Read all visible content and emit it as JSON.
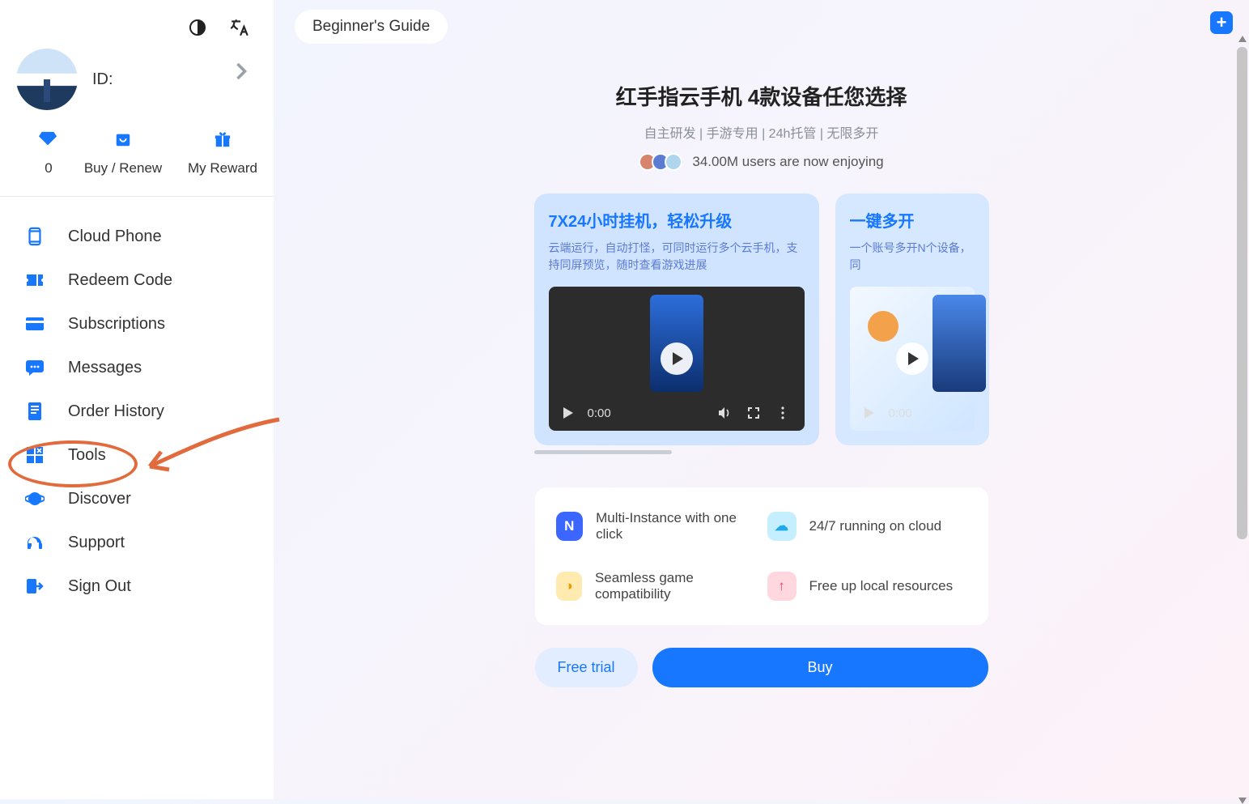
{
  "sidebar": {
    "id_label": "ID:",
    "quick": {
      "balance": "0",
      "buy_renew": "Buy / Renew",
      "my_reward": "My Reward"
    },
    "nav": [
      {
        "label": "Cloud Phone"
      },
      {
        "label": "Redeem Code"
      },
      {
        "label": "Subscriptions"
      },
      {
        "label": "Messages"
      },
      {
        "label": "Order History"
      },
      {
        "label": "Tools"
      },
      {
        "label": "Discover"
      },
      {
        "label": "Support"
      },
      {
        "label": "Sign Out"
      }
    ]
  },
  "header": {
    "guide": "Beginner's Guide"
  },
  "promo": {
    "title": "红手指云手机 4款设备任您选择",
    "subtitle": "自主研发 | 手游专用 | 24h托管 | 无限多开",
    "users": "34.00M users are now enjoying"
  },
  "cards": [
    {
      "title": "7X24小时挂机，轻松升级",
      "desc": "云端运行，自动打怪，可同时运行多个云手机，支持同屏预览，随时查看游戏进展",
      "time": "0:00"
    },
    {
      "title": "一键多开",
      "desc": "一个账号多开N个设备，同",
      "time": "0:00"
    }
  ],
  "features": [
    {
      "label": "Multi-Instance with one click"
    },
    {
      "label": "24/7 running on cloud"
    },
    {
      "label": "Seamless game compatibility"
    },
    {
      "label": "Free up local resources"
    }
  ],
  "cta": {
    "trial": "Free trial",
    "buy": "Buy"
  }
}
